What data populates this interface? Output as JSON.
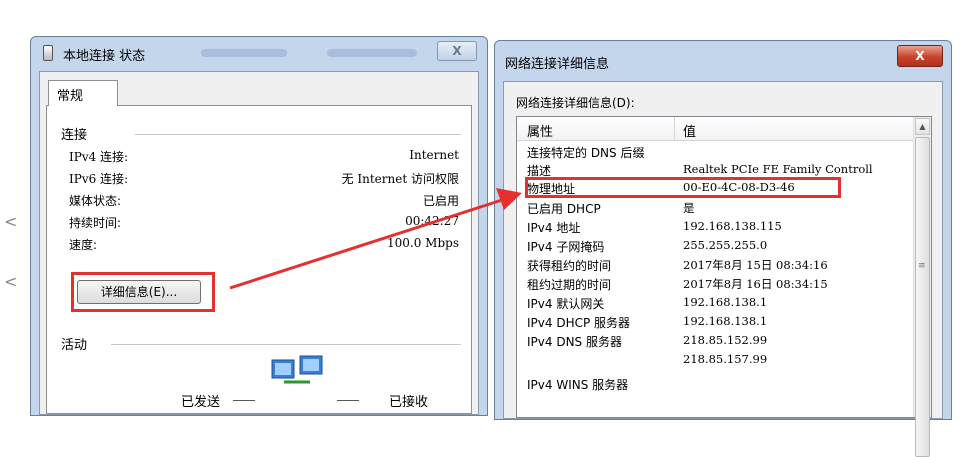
{
  "left_window": {
    "title": "本地连接 状态",
    "close_label": "X",
    "tab_label": "常规",
    "connection_group": "连接",
    "rows": [
      {
        "label": "IPv4 连接:",
        "value": "Internet"
      },
      {
        "label": "IPv6 连接:",
        "value": "无 Internet 访问权限"
      },
      {
        "label": "媒体状态:",
        "value": "已启用"
      },
      {
        "label": "持续时间:",
        "value": "00:42:27"
      },
      {
        "label": "速度:",
        "value": "100.0 Mbps"
      }
    ],
    "details_button": "详细信息(E)...",
    "activity_group": "活动",
    "sent_label": "已发送",
    "received_label": "已接收"
  },
  "right_window": {
    "title": "网络连接详细信息",
    "close_label": "X",
    "caption": "网络连接详细信息(D):",
    "col_property": "属性",
    "col_value": "值",
    "rows": [
      {
        "property": "连接特定的 DNS 后缀",
        "value": ""
      },
      {
        "property": "描述",
        "value": "Realtek PCIe FE Family Controll"
      },
      {
        "property": "物理地址",
        "value": "00-E0-4C-08-D3-46"
      },
      {
        "property": "已启用 DHCP",
        "value": "是"
      },
      {
        "property": "IPv4 地址",
        "value": "192.168.138.115"
      },
      {
        "property": "IPv4 子网掩码",
        "value": "255.255.255.0"
      },
      {
        "property": "获得租约的时间",
        "value": "2017年8月 15日 08:34:16"
      },
      {
        "property": "租约过期的时间",
        "value": "2017年8月 16日 08:34:15"
      },
      {
        "property": "IPv4 默认网关",
        "value": "192.168.138.1"
      },
      {
        "property": "IPv4 DHCP 服务器",
        "value": "192.168.138.1"
      },
      {
        "property": "IPv4 DNS 服务器",
        "value": "218.85.152.99"
      },
      {
        "property": "",
        "value": "218.85.157.99"
      },
      {
        "property": "IPv4 WINS 服务器",
        "value": ""
      }
    ]
  },
  "colors": {
    "annotation_red": "#e53030",
    "window_frame": "#c4d6ec",
    "close_active": "#c7432b"
  }
}
